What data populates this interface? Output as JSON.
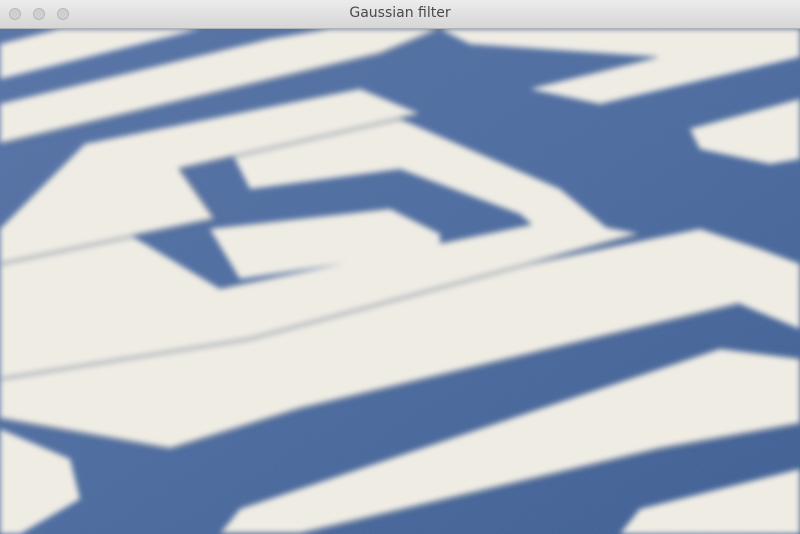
{
  "window": {
    "title": "Gaussian filter"
  },
  "colors": {
    "carpet_blue": "#4f6ea3",
    "carpet_blue_dark": "#2f4e83",
    "carpet_cream": "#efece4",
    "titlebar": "#e3e3e3"
  },
  "icons": {
    "close": "close-icon",
    "minimize": "minimize-icon",
    "maximize": "maximize-icon"
  }
}
